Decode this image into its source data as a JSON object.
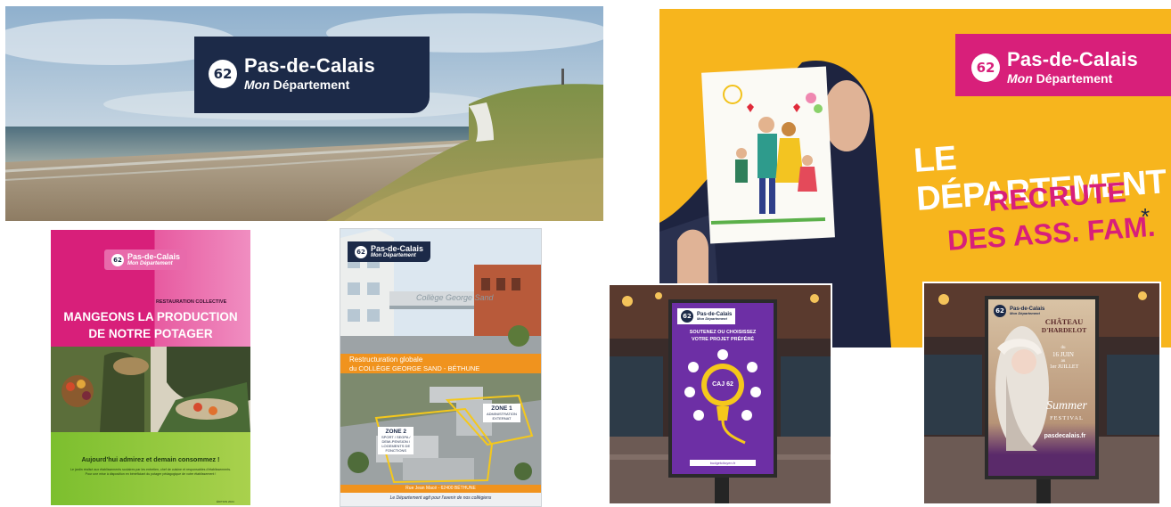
{
  "brand": {
    "number": "62",
    "name": "Pas-de-Calais",
    "tagline_italic": "Mon",
    "tagline": "Département"
  },
  "colors": {
    "navy": "#1c2a48",
    "magenta": "#d81f7a",
    "yellow": "#f7b51d",
    "orange": "#f0931e",
    "purple": "#6d2fa5",
    "green": "#8dc63f"
  },
  "potager": {
    "kicker": "RESTAURATION COLLECTIVE",
    "title_line1": "MANGEONS LA PRODUCTION",
    "title_line2": "DE NOTRE POTAGER",
    "slogan": "Aujourd'hui admirez et demain consommez !",
    "body": "Le jardin réalisé aux établissements scolaires par les entretien, chef de cuisine et responsables d'établissements. Pour une mise à disposition en bénéficiant du potager pédagogique de votre établissement !",
    "edition": "ÉDITION 2024"
  },
  "college": {
    "banner_line1": "Restructuration globale",
    "banner_line2": "du COLLÈGE GEORGE SAND - BÉTHUNE",
    "sign_text": "Collège George Sand",
    "zone1_line1": "ZONE 1",
    "zone1_line2": "ADMINISTRATION",
    "zone1_line3": "EXTERNAT",
    "zone2_line1": "ZONE 2",
    "zone2_line2": "SPORT / SEGPA /",
    "zone2_line3": "DEMI-PENSION /",
    "zone2_line4": "LOGEMENTS DE",
    "zone2_line5": "FONCTIONS",
    "address": "Rue Jean Macé - 62400 BÉTHUNE",
    "footer": "Le Département agit pour l'avenir de nos collégiens"
  },
  "recrute": {
    "line1": "LE DÉPARTEMENT",
    "line2": "RECRUTE",
    "line3": "DES ASS. FAM.",
    "asterisk": "*"
  },
  "projet": {
    "line1": "SOUTENEZ OU CHOISISSEZ",
    "line2": "VOTRE PROJET PRÉFÉRÉ",
    "logo_text": "CAJ 62",
    "url": "budgetcitoyen.fr"
  },
  "chateau": {
    "title_line1": "CHÂTEAU",
    "title_line2": "D'HARDELOT",
    "date_line1": "du",
    "date_line2": "16 JUIN",
    "date_line3": "au",
    "date_line4": "1er JUILLET",
    "festival_line1": "Summer",
    "festival_line2": "FESTIVAL",
    "url": "pasdecalais.fr"
  }
}
